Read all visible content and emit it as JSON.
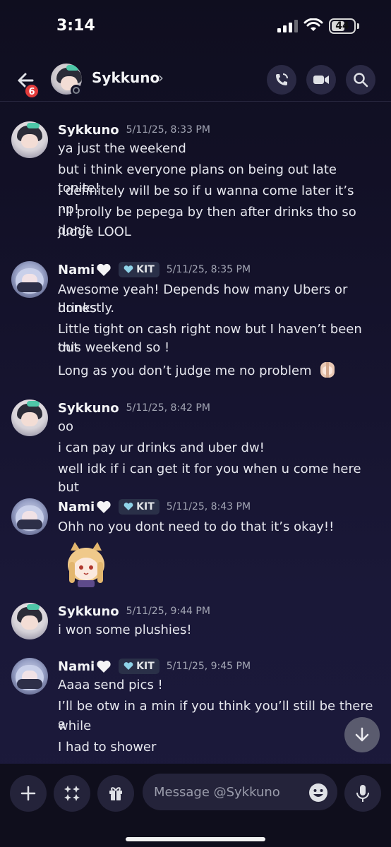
{
  "status_bar": {
    "time": "3:14",
    "battery": "44"
  },
  "header": {
    "back_badge": "6",
    "contact_name": "Sykkuno",
    "chevron": "›"
  },
  "messages": [
    {
      "author": "Sykkuno",
      "timestamp": "5/11/25, 8:33 PM",
      "lines": [
        "ya just the weekend",
        "but i think everyone plans on being out late tonite!",
        "i definitely will be so if u wanna come later it’s np!",
        "i’ll prolly be pepega by then after drinks tho so don’t",
        "judge LOOL"
      ]
    },
    {
      "author": "Nami",
      "tag": "KIT",
      "timestamp": "5/11/25, 8:35 PM",
      "lines": [
        "Awesome yeah! Depends how many Ubers or drinks",
        "honestly.",
        "Little tight on cash right now but I haven’t been out",
        "this weekend so !",
        "Long as you don’t judge me no problem"
      ]
    },
    {
      "author": "Sykkuno",
      "timestamp": "5/11/25, 8:42 PM",
      "lines": [
        "oo",
        "i can pay ur drinks and uber dw!",
        "well idk if i can get it for you when u come here but"
      ]
    },
    {
      "author": "Nami",
      "tag": "KIT",
      "timestamp": "5/11/25, 8:43 PM",
      "lines": [
        "Ohh no you dont need to do that it’s okay!!"
      ],
      "sticker": "anime-girl-sticker"
    },
    {
      "author": "Sykkuno",
      "timestamp": "5/11/25, 9:44 PM",
      "lines": [
        "i won some plushies!"
      ]
    },
    {
      "author": "Nami",
      "tag": "KIT",
      "timestamp": "5/11/25, 9:45 PM",
      "lines": [
        "Aaaa send pics !",
        "I’ll be otw in a min if you think you’ll still be there a",
        "while",
        "I had to shower"
      ]
    }
  ],
  "composer": {
    "placeholder": "Message @Sykkuno"
  },
  "colors": {
    "background": "#14122b",
    "accent_badge": "#e23b3b",
    "tag_bg": "#2a3048"
  },
  "icons": [
    "back-arrow-icon",
    "voice-call-icon",
    "video-call-icon",
    "search-icon",
    "plus-icon",
    "apps-icon",
    "gift-icon",
    "emoji-icon",
    "microphone-icon",
    "arrow-down-icon"
  ]
}
